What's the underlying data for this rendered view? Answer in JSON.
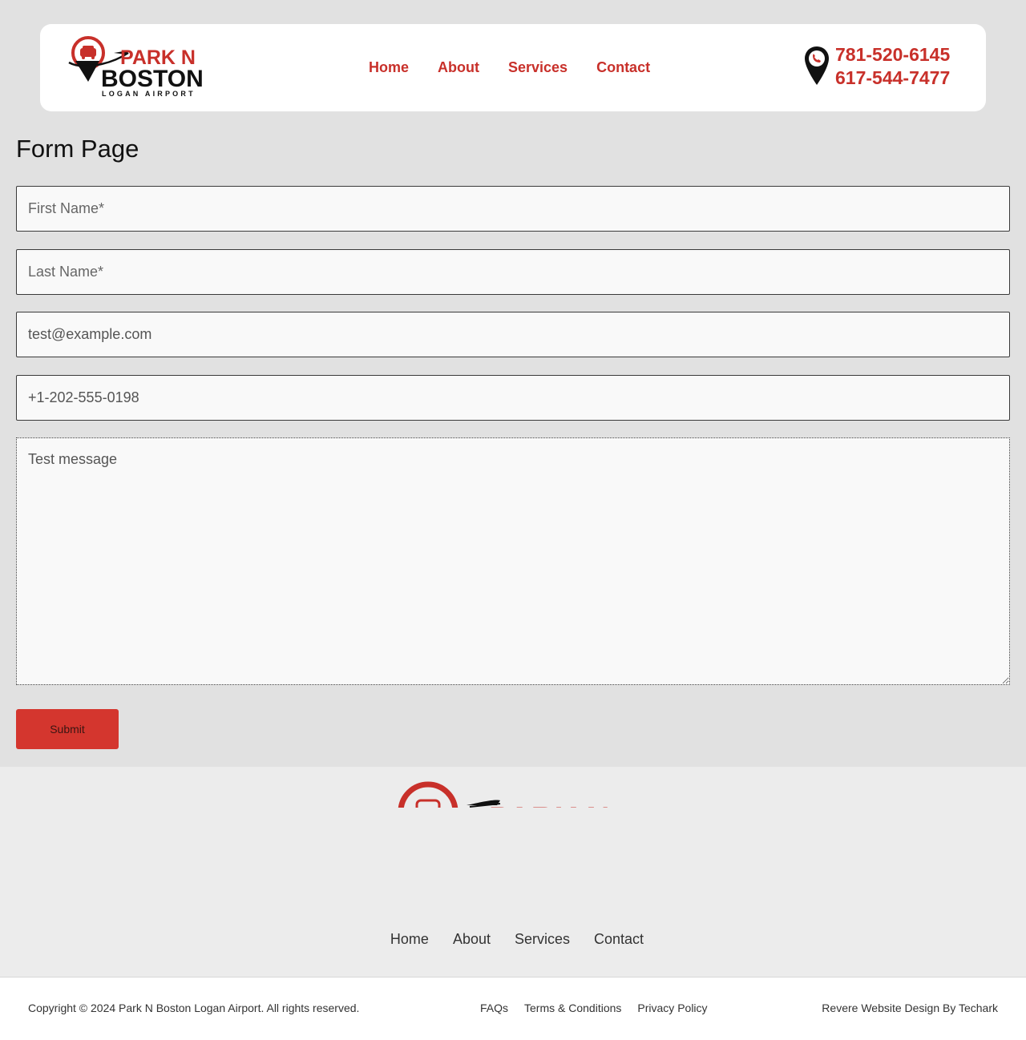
{
  "header": {
    "logo": {
      "line1": "PARK N",
      "line2": "BOSTON",
      "line3": "LOGAN AIRPORT"
    },
    "nav": [
      {
        "label": "Home"
      },
      {
        "label": "About"
      },
      {
        "label": "Services"
      },
      {
        "label": "Contact"
      }
    ],
    "phones": [
      "781-520-6145",
      "617-544-7477"
    ]
  },
  "main": {
    "title": "Form Page",
    "form": {
      "first_name_placeholder": "First Name*",
      "last_name_placeholder": "Last Name*",
      "email_value": "test@example.com",
      "phone_value": "+1-202-555-0198",
      "message_value": "Test message",
      "submit_label": "Submit"
    }
  },
  "footer": {
    "logo": {
      "line1": "PARK N"
    },
    "nav": [
      {
        "label": "Home"
      },
      {
        "label": "About"
      },
      {
        "label": "Services"
      },
      {
        "label": "Contact"
      }
    ],
    "copyright": "Copyright © 2024 Park N Boston Logan Airport. All rights reserved.",
    "legal_links": [
      {
        "label": "FAQs"
      },
      {
        "label": "Terms & Conditions"
      },
      {
        "label": "Privacy Policy"
      }
    ],
    "credit": "Revere Website Design By Techark"
  },
  "colors": {
    "brand_red": "#c8302a",
    "button_red": "#d4362e",
    "page_bg": "#e1e1e1"
  }
}
